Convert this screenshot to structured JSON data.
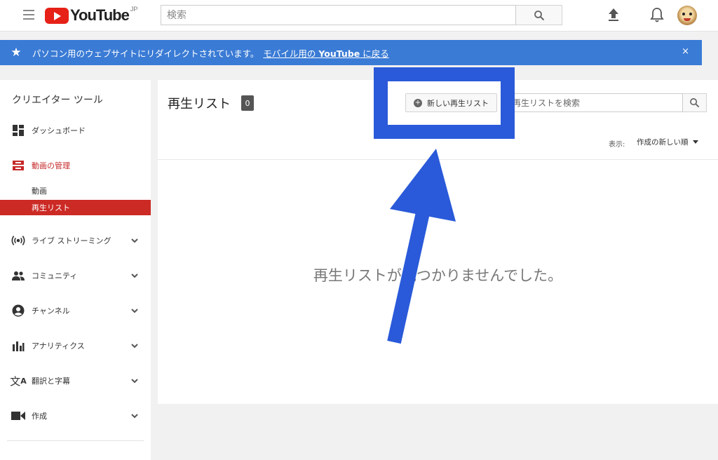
{
  "header": {
    "logo_text": "YouTube",
    "logo_region": "JP",
    "search_placeholder": "検索",
    "icons": [
      "menu-icon",
      "search-icon",
      "upload-icon",
      "bell-icon",
      "avatar"
    ]
  },
  "banner": {
    "message": "パソコン用のウェブサイトにリダイレクトされています。",
    "link_prefix": "モバイル用の ",
    "link_bold": "YouTube",
    "link_suffix": " に戻る",
    "close": "×",
    "color": "#3a7bd5"
  },
  "sidebar": {
    "title": "クリエイター ツール",
    "dashboard": "ダッシュボード",
    "video_manager": "動画の管理",
    "sub_videos": "動画",
    "sub_playlists": "再生リスト",
    "live": "ライブ ストリーミング",
    "community": "コミュニティ",
    "channel": "チャンネル",
    "analytics": "アナリティクス",
    "translations": "翻訳と字幕",
    "create": "作成",
    "active_color": "#cc2a25"
  },
  "main": {
    "title": "再生リスト",
    "count": "0",
    "new_playlist_button": "新しい再生リスト",
    "search_placeholder": "再生リストを検索",
    "sort_label": "表示:",
    "sort_value": "作成の新しい順",
    "empty_message": "再生リストが見つかりませんでした。"
  },
  "annotation": {
    "color": "#2a5ad9"
  }
}
